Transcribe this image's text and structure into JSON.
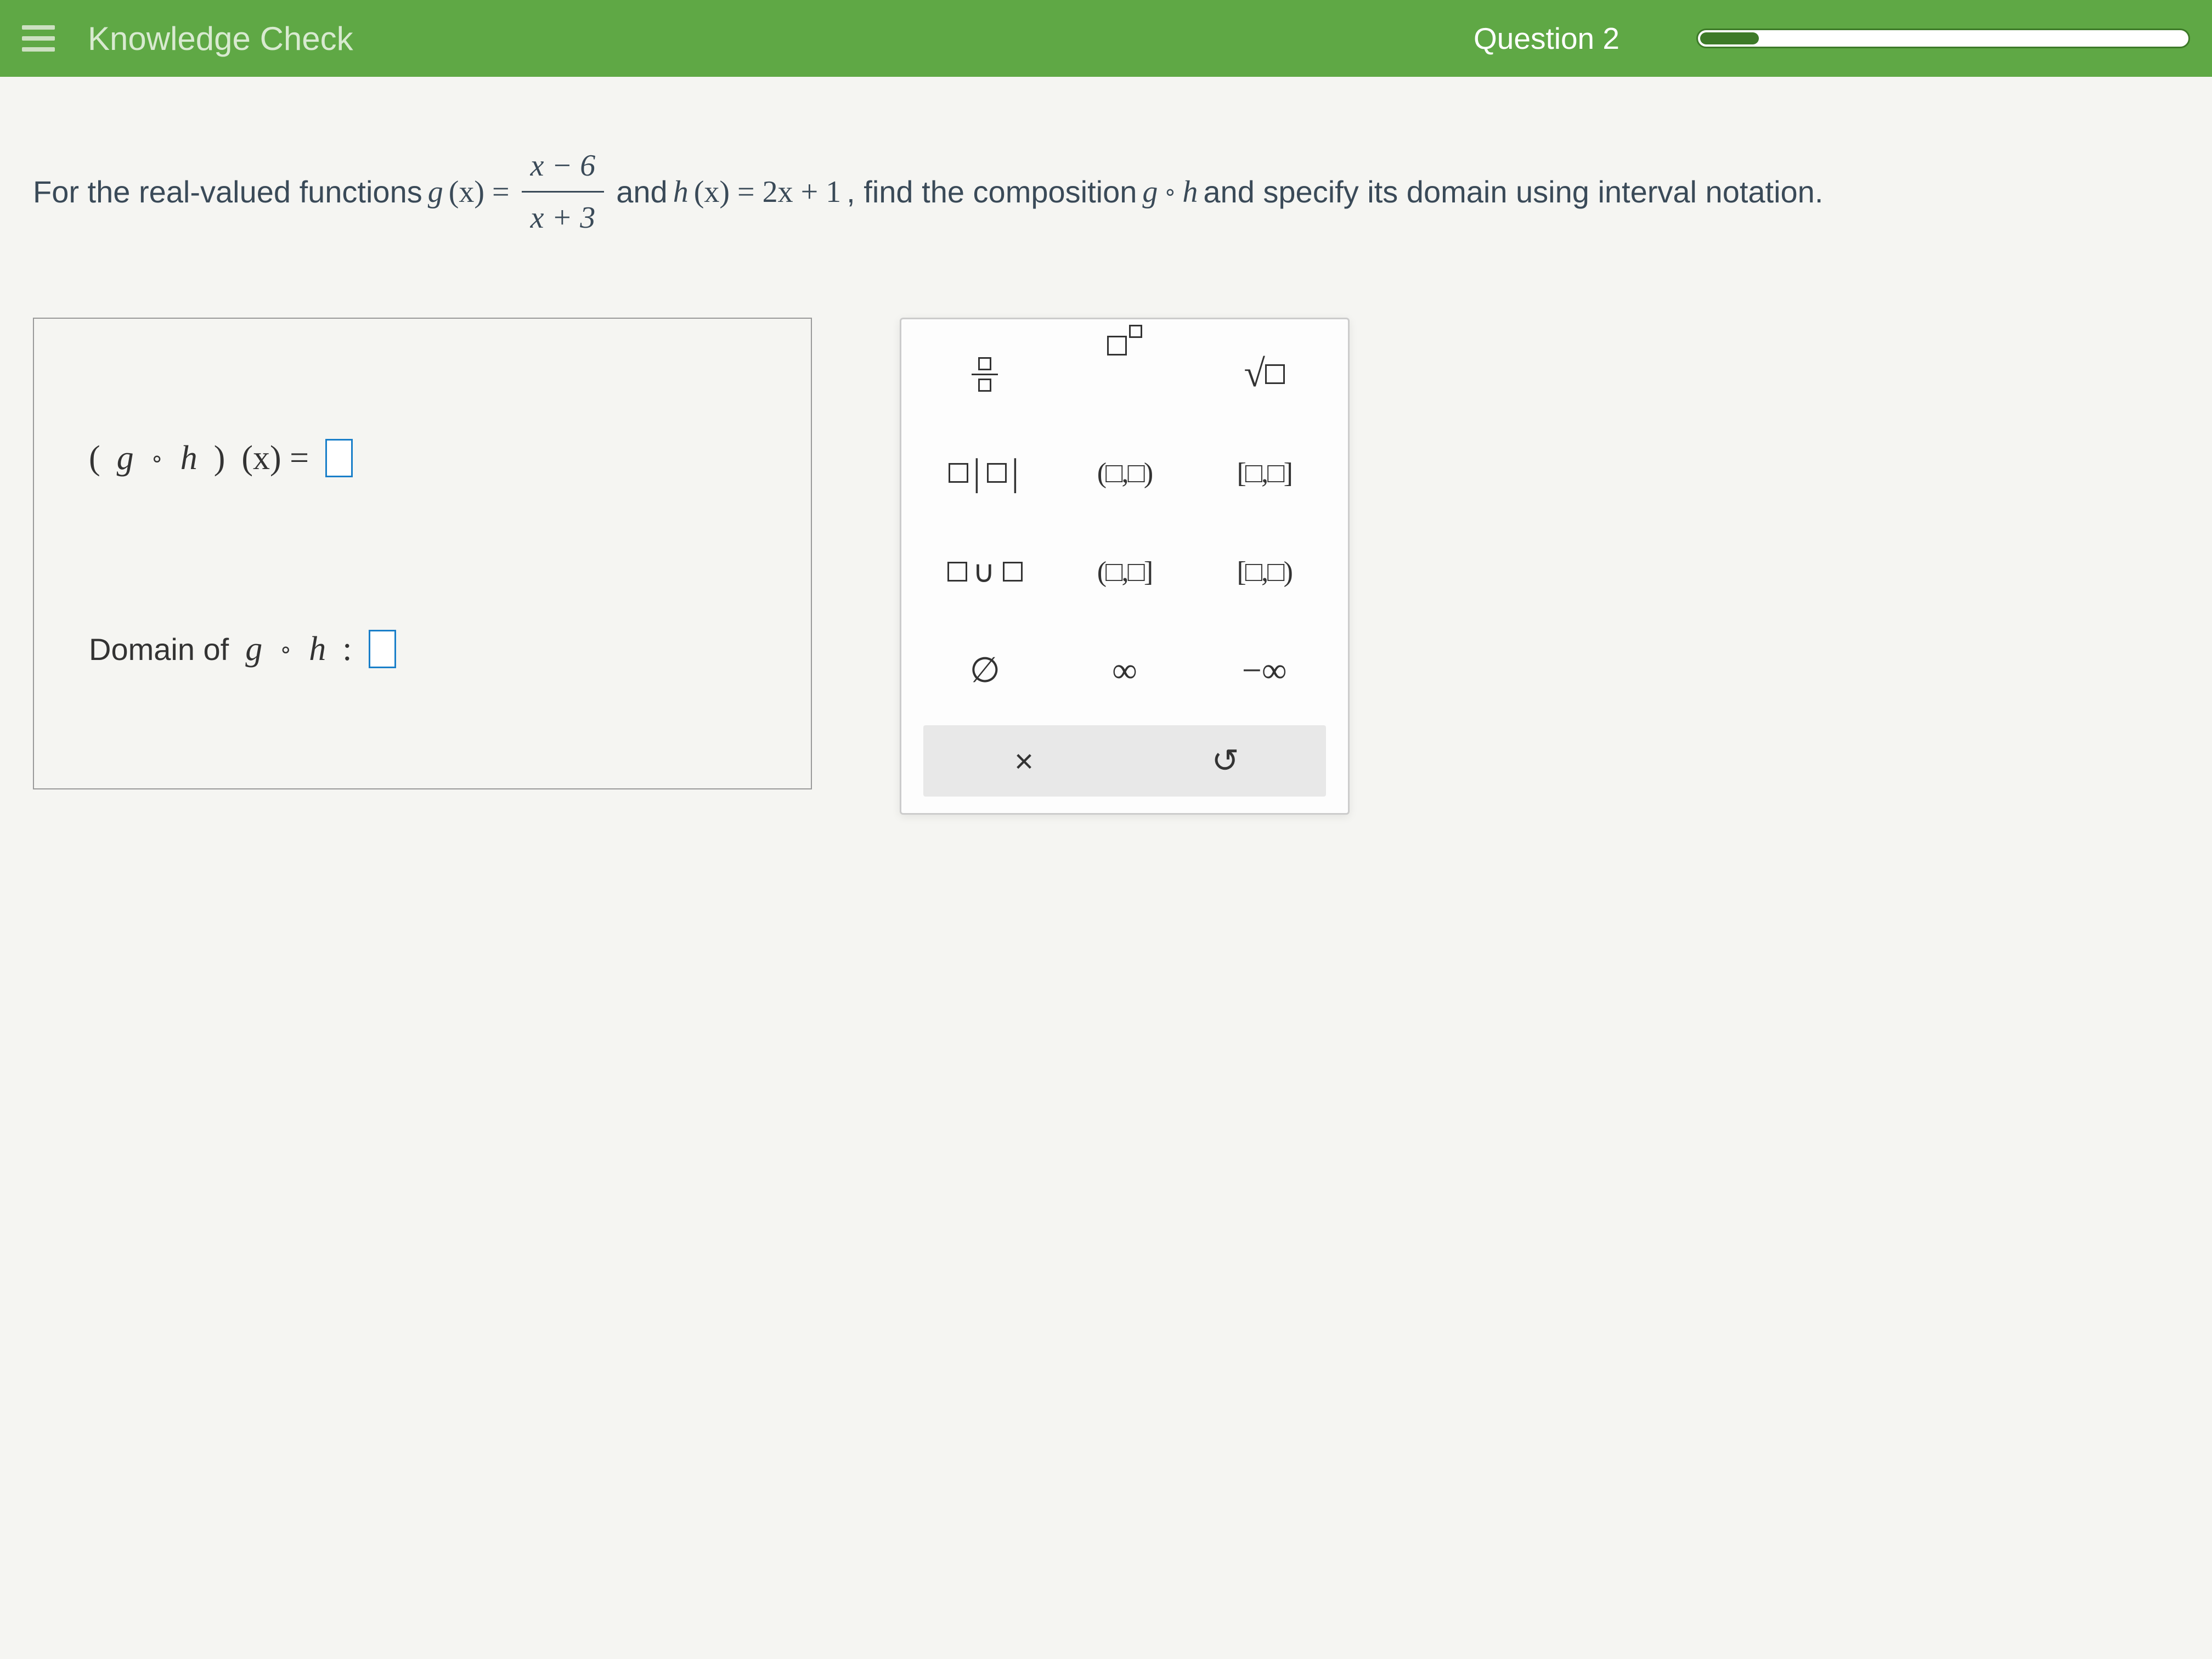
{
  "header": {
    "title": "Knowledge Check",
    "question_label": "Question 2"
  },
  "question": {
    "intro": "For the real-valued functions",
    "g_label": "g",
    "g_of": "(x) =",
    "frac_num": "x − 6",
    "frac_den": "x + 3",
    "and": "and",
    "h_label": "h",
    "h_of": "(x) = 2x + 1",
    "tail": ", find the composition",
    "comp1": "g",
    "comp_ring": "∘",
    "comp2": "h",
    "tail2": "and specify its domain using interval notation."
  },
  "answers": {
    "comp_label_g": "g",
    "comp_ring": "∘",
    "comp_label_h": "h",
    "comp_paren": "(x) =",
    "domain_prefix": "Domain of",
    "domain_g": "g",
    "domain_ring": "∘",
    "domain_h": "h",
    "colon": ":"
  },
  "palette": {
    "open_open": "(□,□)",
    "closed_closed": "[□,□]",
    "open_closed": "(□,□]",
    "closed_open": "[□,□)",
    "empty_set": "∅",
    "infinity": "∞",
    "neg_infinity": "−∞",
    "clear": "×",
    "reset": "↺"
  }
}
